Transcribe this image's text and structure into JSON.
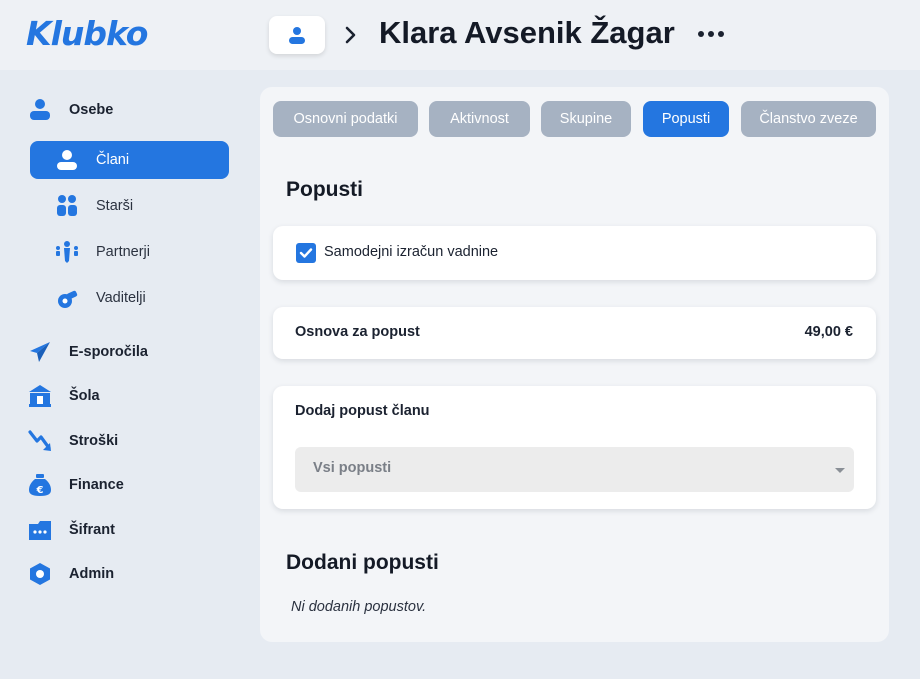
{
  "app": {
    "logo": "Klubko"
  },
  "header": {
    "title": "Klara Avsenik Žagar"
  },
  "icons": {
    "avatar": "user-icon",
    "breadcrumb_separator": "chevron-right-icon",
    "more": "more-horizontal-icon"
  },
  "sidebar": {
    "sections": [
      {
        "label": "Osebe",
        "icon": "user-icon"
      },
      {
        "label": "E-sporočila",
        "icon": "send-icon"
      },
      {
        "label": "Šola",
        "icon": "school-icon"
      },
      {
        "label": "Stroški",
        "icon": "trend-down-icon"
      },
      {
        "label": "Finance",
        "icon": "money-bag-icon"
      },
      {
        "label": "Šifrant",
        "icon": "codebook-icon"
      },
      {
        "label": "Admin",
        "icon": "hexagon-icon"
      }
    ],
    "subitems": [
      {
        "label": "Člani",
        "icon": "member-icon",
        "active": true
      },
      {
        "label": "Starši",
        "icon": "parents-icon",
        "active": false
      },
      {
        "label": "Partnerji",
        "icon": "partners-icon",
        "active": false
      },
      {
        "label": "Vaditelji",
        "icon": "whistle-icon",
        "active": false
      }
    ]
  },
  "tabs": [
    {
      "label": "Osnovni podatki",
      "active": false
    },
    {
      "label": "Aktivnost",
      "active": false
    },
    {
      "label": "Skupine",
      "active": false
    },
    {
      "label": "Popusti",
      "active": true
    },
    {
      "label": "Članstvo zveze",
      "active": false
    }
  ],
  "discounts": {
    "title": "Popusti",
    "auto_calc": {
      "label": "Samodejni izračun vadnine",
      "checked": true
    },
    "base": {
      "label": "Osnova za popust",
      "value": "49,00 €"
    },
    "add": {
      "label": "Dodaj popust članu",
      "select_value": "Vsi popusti"
    },
    "added_title": "Dodani popusti",
    "empty_text": "Ni dodanih popustov."
  },
  "colors": {
    "accent": "#2476e0",
    "tab_inactive": "#a6b2c2",
    "background": "#e6ebf2"
  }
}
